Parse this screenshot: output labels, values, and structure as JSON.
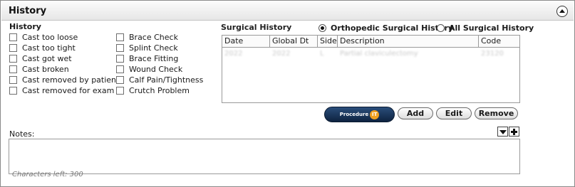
{
  "header": {
    "title": "History"
  },
  "history": {
    "heading": "History",
    "left_items": [
      {
        "label": "Cast too loose",
        "checked": false
      },
      {
        "label": "Cast too tight",
        "checked": false
      },
      {
        "label": "Cast got wet",
        "checked": false
      },
      {
        "label": "Cast broken",
        "checked": false
      },
      {
        "label": "Cast removed by patient",
        "checked": false
      },
      {
        "label": "Cast removed for exam",
        "checked": false
      }
    ],
    "right_items": [
      {
        "label": "Brace Check",
        "checked": false
      },
      {
        "label": "Splint Check",
        "checked": false
      },
      {
        "label": "Brace Fitting",
        "checked": false
      },
      {
        "label": "Wound Check",
        "checked": false
      },
      {
        "label": "Calf Pain/Tightness",
        "checked": false
      },
      {
        "label": "Crutch Problem",
        "checked": false
      }
    ]
  },
  "surgical_history": {
    "heading": "Surgical History",
    "filter": {
      "selected": "Orthopedic Surgical History",
      "options": [
        "Orthopedic Surgical History",
        "All Surgical History"
      ]
    },
    "columns": [
      "Date",
      "Global Dt",
      "Side",
      "Description",
      "Code"
    ],
    "rows": [
      {
        "date": "2022",
        "global_dt": "2022",
        "side": "L",
        "description": "Partial claviculectomy",
        "code": "23120"
      }
    ]
  },
  "actions": {
    "procedure_label": "Procedure",
    "procedure_badge": "IT",
    "add": "Add",
    "edit": "Edit",
    "remove": "Remove"
  },
  "notes": {
    "label": "Notes:",
    "value": "",
    "chars_left": "Characters left: 300"
  },
  "colors": {
    "procedure_button": "#1b3a63",
    "procedure_badge": "#f0a020",
    "header_bg": "#ececec"
  }
}
